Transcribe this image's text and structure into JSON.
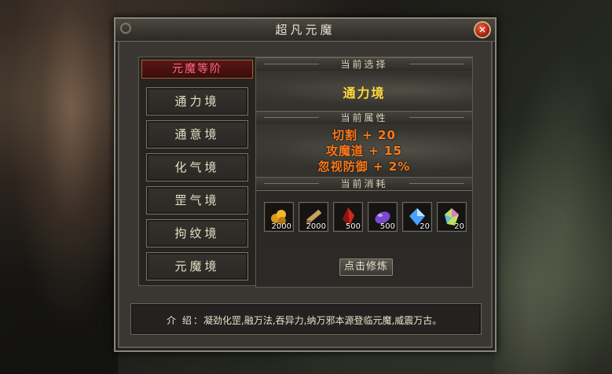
{
  "window": {
    "title": "超凡元魔",
    "close_label": "✕"
  },
  "left": {
    "header": "元魔等阶",
    "realms": [
      "通力境",
      "通意境",
      "化气境",
      "罡气境",
      "拘纹境",
      "元魔境"
    ]
  },
  "right": {
    "current_selection_label": "当前选择",
    "selected_realm": "通力境",
    "current_attributes_label": "当前属性",
    "attributes": [
      "切割 + 20",
      "攻魔道 + 15",
      "忽视防御 + 2%"
    ],
    "current_cost_label": "当前消耗",
    "cost_items": [
      {
        "icon": "gold-ore-icon",
        "count": "2000",
        "color": "#e0a020"
      },
      {
        "icon": "scroll-icon",
        "count": "2000",
        "color": "#c8a060"
      },
      {
        "icon": "red-crystal-icon",
        "count": "500",
        "color": "#d0281c"
      },
      {
        "icon": "purple-gem-icon",
        "count": "500",
        "color": "#7a4ad0"
      },
      {
        "icon": "blue-diamond-icon",
        "count": "20",
        "color": "#4aa0ff"
      },
      {
        "icon": "rainbow-gem-icon",
        "count": "20",
        "color": "#c0e060"
      }
    ],
    "cultivate_button": "点击修炼"
  },
  "intro": {
    "label": "介 绍：",
    "text": "凝劲化罡,融万法,吞异力,纳万邪本源登临元魔,威震万古。"
  }
}
